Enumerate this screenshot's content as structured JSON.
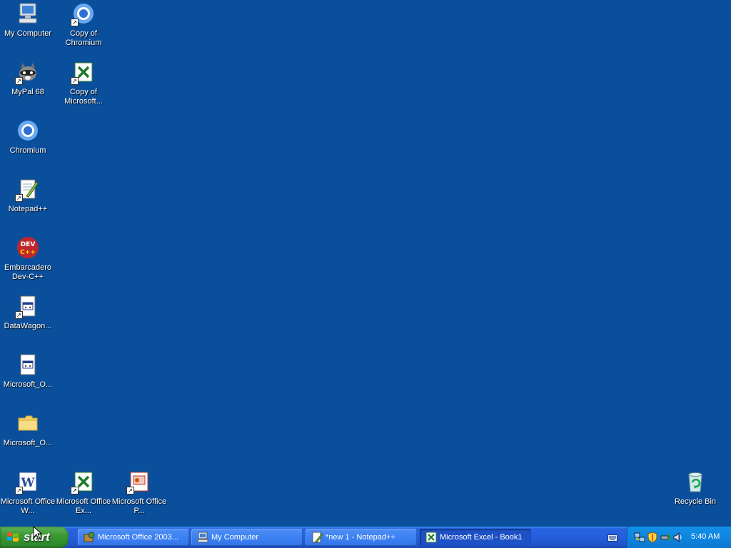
{
  "desktop": {
    "background_color": "#0a4f9c",
    "icons": {
      "my_computer": "My Computer",
      "copy_of_chromium": "Copy of Chromium",
      "mypal": "MyPal 68",
      "copy_of_microsoft": "Copy of Microsoft...",
      "chromium": "Chromium",
      "notepadpp": "Notepad++",
      "devcpp": "Embarcadero Dev-C++",
      "datawagon": "DataWagon...",
      "ms_o_1": "Microsoft_O...",
      "ms_o_2": "Microsoft_O...",
      "ms_word": "Microsoft Office W...",
      "ms_excel": "Microsoft Office Ex...",
      "ms_powerpoint": "Microsoft Office P...",
      "recycle_bin": "Recycle Bin"
    }
  },
  "taskbar": {
    "start_label": "start",
    "buttons": [
      {
        "label": "Microsoft Office 2003...",
        "icon": "setup-icon",
        "active": false
      },
      {
        "label": "My Computer",
        "icon": "my-computer-icon",
        "active": false
      },
      {
        "label": "*new 1 - Notepad++",
        "icon": "notepadpp-icon",
        "active": false
      },
      {
        "label": "Microsoft Excel - Book1",
        "icon": "excel-icon",
        "active": true
      }
    ],
    "tray": {
      "icons": [
        "network-icon",
        "security-shield-icon",
        "safely-remove-icon",
        "volume-icon"
      ],
      "clock": "5:40 AM"
    }
  }
}
